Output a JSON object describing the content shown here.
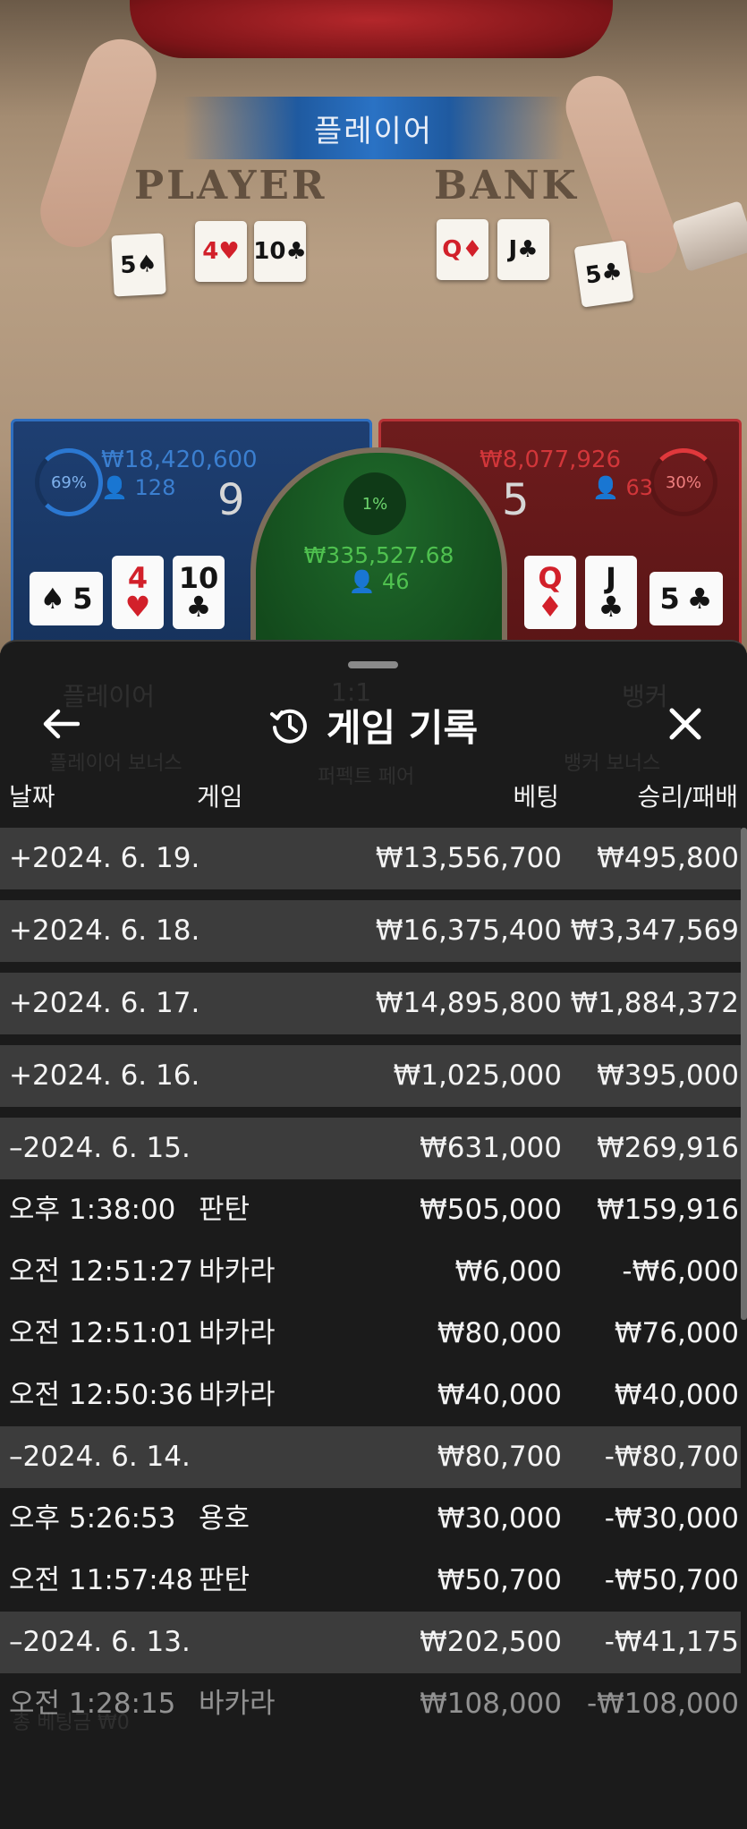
{
  "scene": {
    "result_banner": "플레이어",
    "player_word": "PLAYER",
    "banker_word": "BANK"
  },
  "table_cards": {
    "player": [
      {
        "rank": "5",
        "suit": "♠",
        "color": "black"
      },
      {
        "rank": "4",
        "suit": "♥",
        "color": "red"
      },
      {
        "rank": "10",
        "suit": "♣",
        "color": "black"
      }
    ],
    "banker": [
      {
        "rank": "Q",
        "suit": "♦",
        "color": "red"
      },
      {
        "rank": "J",
        "suit": "♣",
        "color": "black"
      },
      {
        "rank": "5",
        "suit": "♣",
        "color": "black"
      }
    ]
  },
  "bets": {
    "player": {
      "percent": "69%",
      "amount": "₩18,420,600",
      "count": "128",
      "score": "9",
      "color": "#2f6fc0"
    },
    "tie": {
      "percent": "1%",
      "amount": "₩335,527.68",
      "count": "46",
      "color": "#4fc14f"
    },
    "banker": {
      "percent": "30%",
      "amount": "₩8,077,926",
      "count": "63",
      "score": "5",
      "color": "#d2363a"
    }
  },
  "sheet": {
    "title": "게임 기록",
    "back_icon": "arrow-left-icon",
    "history_icon": "history-clock-icon",
    "close_icon": "close-icon",
    "columns": {
      "date": "날짜",
      "game": "게임",
      "bet": "베팅",
      "win_loss": "승리/패배"
    },
    "background_ghost": {
      "player": "플레이어",
      "ratio": "1:1",
      "banker": "뱅커",
      "player_bonus": "플레이어 보너스",
      "perfect_pair": "퍼펙트 페어",
      "banker_bonus": "뱅커 보너스",
      "total_bet": "총 베팅금 ₩0"
    },
    "rows": [
      {
        "type": "day",
        "date": "+2024. 6. 19.",
        "game": "",
        "bet": "₩13,556,700",
        "win_loss": "₩495,800"
      },
      {
        "type": "day",
        "date": "+2024. 6. 18.",
        "game": "",
        "bet": "₩16,375,400",
        "win_loss": "₩3,347,569"
      },
      {
        "type": "day",
        "date": "+2024. 6. 17.",
        "game": "",
        "bet": "₩14,895,800",
        "win_loss": "₩1,884,372"
      },
      {
        "type": "day",
        "date": "+2024. 6. 16.",
        "game": "",
        "bet": "₩1,025,000",
        "win_loss": "₩395,000"
      },
      {
        "type": "day",
        "date": "–2024. 6. 15.",
        "game": "",
        "bet": "₩631,000",
        "win_loss": "₩269,916"
      },
      {
        "type": "item",
        "date": "오후 1:38:00",
        "game": "판탄",
        "bet": "₩505,000",
        "win_loss": "₩159,916"
      },
      {
        "type": "item",
        "date": "오전 12:51:27",
        "game": "바카라",
        "bet": "₩6,000",
        "win_loss": "-₩6,000"
      },
      {
        "type": "item",
        "date": "오전 12:51:01",
        "game": "바카라",
        "bet": "₩80,000",
        "win_loss": "₩76,000"
      },
      {
        "type": "item",
        "date": "오전 12:50:36",
        "game": "바카라",
        "bet": "₩40,000",
        "win_loss": "₩40,000"
      },
      {
        "type": "day",
        "date": "–2024. 6. 14.",
        "game": "",
        "bet": "₩80,700",
        "win_loss": "-₩80,700"
      },
      {
        "type": "item",
        "date": "오후 5:26:53",
        "game": "용호",
        "bet": "₩30,000",
        "win_loss": "-₩30,000"
      },
      {
        "type": "item",
        "date": "오전 11:57:48",
        "game": "판탄",
        "bet": "₩50,700",
        "win_loss": "-₩50,700"
      },
      {
        "type": "day",
        "date": "–2024. 6. 13.",
        "game": "",
        "bet": "₩202,500",
        "win_loss": "-₩41,175"
      },
      {
        "type": "item",
        "date": "오전 1:28:15",
        "game": "바카라",
        "bet": "₩108,000",
        "win_loss": "-₩108,000"
      }
    ]
  }
}
